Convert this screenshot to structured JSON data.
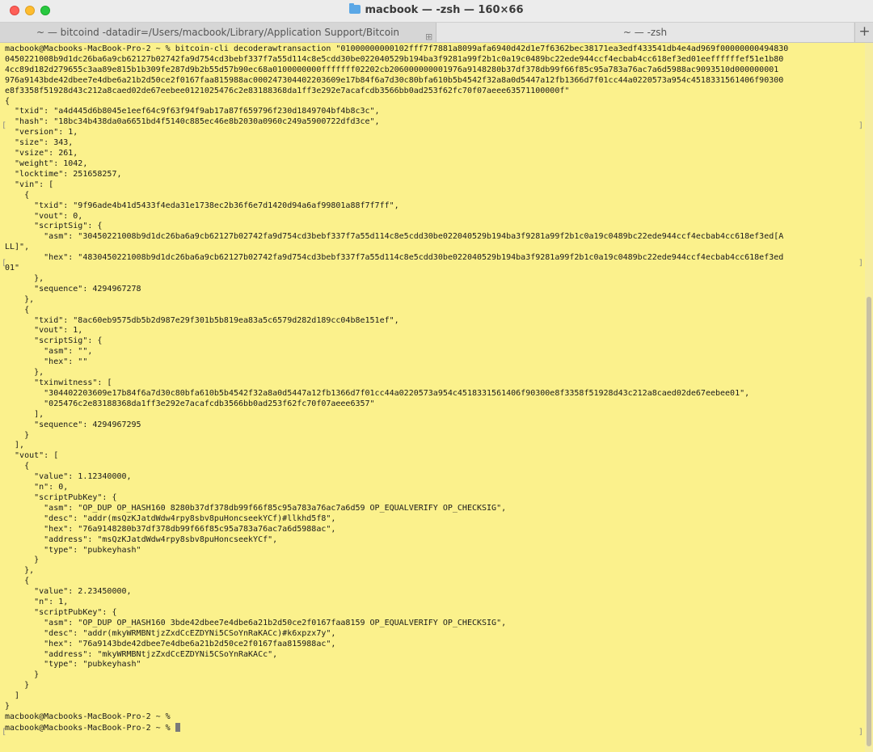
{
  "window": {
    "title": "macbook — -zsh — 160×66",
    "tabs": [
      {
        "label": "~ — bitcoind -datadir=/Users/macbook/Library/Application Support/Bitcoin"
      },
      {
        "label": "~ — -zsh"
      }
    ],
    "new_tab_symbol": "+",
    "tab_close_symbol": "⊞"
  },
  "terminal": {
    "lines": [
      "macbook@Macbooks-MacBook-Pro-2 ~ % bitcoin-cli decoderawtransaction \"01000000000102fff7f7881a8099afa6940d42d1e7f6362bec38171ea3edf433541db4e4ad969f00000000494830",
      "0450221008b9d1dc26ba6a9cb62127b02742fa9d754cd3bebf337f7a55d114c8e5cdd30be022040529b194ba3f9281a99f2b1c0a19c0489bc22ede944ccf4ecbab4cc618ef3ed01eeffffffef51e1b80",
      "4cc89d182d279655c3aa89e815b1b309fe287d9b2b55d57b90ec68a0100000000fffffff02202cb206000000001976a9148280b37df378db99f66f85c95a783a76ac7a6d5988ac9093510d000000001",
      "976a9143bde42dbee7e4dbe6a21b2d50ce2f0167faa815988ac000247304402203609e17b84f6a7d30c80bfa610b5b4542f32a8a0d5447a12fb1366d7f01cc44a0220573a954c4518331561406f90300",
      "e8f3358f51928d43c212a8caed02de67eebee0121025476c2e83188368da1ff3e292e7acafcdb3566bb0ad253f62fc70f07aeee63571100000f\"",
      "{",
      "  \"txid\": \"a4d445d6b8045e1eef64c9f63f94f9ab17a87f659796f230d1849704bf4b8c3c\",",
      "  \"hash\": \"18bc34b438da0a6651bd4f5140c885ec46e8b2030a0960c249a5900722dfd3ce\",",
      "  \"version\": 1,",
      "  \"size\": 343,",
      "  \"vsize\": 261,",
      "  \"weight\": 1042,",
      "  \"locktime\": 251658257,",
      "  \"vin\": [",
      "    {",
      "      \"txid\": \"9f96ade4b41d5433f4eda31e1738ec2b36f6e7d1420d94a6af99801a88f7f7ff\",",
      "      \"vout\": 0,",
      "      \"scriptSig\": {",
      "        \"asm\": \"30450221008b9d1dc26ba6a9cb62127b02742fa9d754cd3bebf337f7a55d114c8e5cdd30be022040529b194ba3f9281a99f2b1c0a19c0489bc22ede944ccf4ecbab4cc618ef3ed[A",
      "LL]\",",
      "        \"hex\": \"4830450221008b9d1dc26ba6a9cb62127b02742fa9d754cd3bebf337f7a55d114c8e5cdd30be022040529b194ba3f9281a99f2b1c0a19c0489bc22ede944ccf4ecbab4cc618ef3ed",
      "01\"",
      "      },",
      "      \"sequence\": 4294967278",
      "    },",
      "    {",
      "      \"txid\": \"8ac60eb9575db5b2d987e29f301b5b819ea83a5c6579d282d189cc04b8e151ef\",",
      "      \"vout\": 1,",
      "      \"scriptSig\": {",
      "        \"asm\": \"\",",
      "        \"hex\": \"\"",
      "      },",
      "      \"txinwitness\": [",
      "        \"304402203609e17b84f6a7d30c80bfa610b5b4542f32a8a0d5447a12fb1366d7f01cc44a0220573a954c4518331561406f90300e8f3358f51928d43c212a8caed02de67eebee01\",",
      "        \"025476c2e83188368da1ff3e292e7acafcdb3566bb0ad253f62fc70f07aeee6357\"",
      "      ],",
      "      \"sequence\": 4294967295",
      "    }",
      "  ],",
      "  \"vout\": [",
      "    {",
      "      \"value\": 1.12340000,",
      "      \"n\": 0,",
      "      \"scriptPubKey\": {",
      "        \"asm\": \"OP_DUP OP_HASH160 8280b37df378db99f66f85c95a783a76ac7a6d59 OP_EQUALVERIFY OP_CHECKSIG\",",
      "        \"desc\": \"addr(msQzKJatdWdw4rpy8sbv8puHoncseekYCf)#llkhd5f8\",",
      "        \"hex\": \"76a9148280b37df378db99f66f85c95a783a76ac7a6d5988ac\",",
      "        \"address\": \"msQzKJatdWdw4rpy8sbv8puHoncseekYCf\",",
      "        \"type\": \"pubkeyhash\"",
      "      }",
      "    },",
      "    {",
      "      \"value\": 2.23450000,",
      "      \"n\": 1,",
      "      \"scriptPubKey\": {",
      "        \"asm\": \"OP_DUP OP_HASH160 3bde42dbee7e4dbe6a21b2d50ce2f0167faa8159 OP_EQUALVERIFY OP_CHECKSIG\",",
      "        \"desc\": \"addr(mkyWRMBNtjzZxdCcEZDYNi5CSoYnRaKACc)#k6xpzx7y\",",
      "        \"hex\": \"76a9143bde42dbee7e4dbe6a21b2d50ce2f0167faa815988ac\",",
      "        \"address\": \"mkyWRMBNtjzZxdCcEZDYNi5CSoYnRaKACc\",",
      "        \"type\": \"pubkeyhash\"",
      "      }",
      "    }",
      "  ]",
      "}",
      "macbook@Macbooks-MacBook-Pro-2 ~ %",
      "macbook@Macbooks-MacBook-Pro-2 ~ % "
    ]
  },
  "colors": {
    "terminal_background": "#fbf18c",
    "text": "#1a1a1a",
    "cursor": "#7a7a7a"
  }
}
